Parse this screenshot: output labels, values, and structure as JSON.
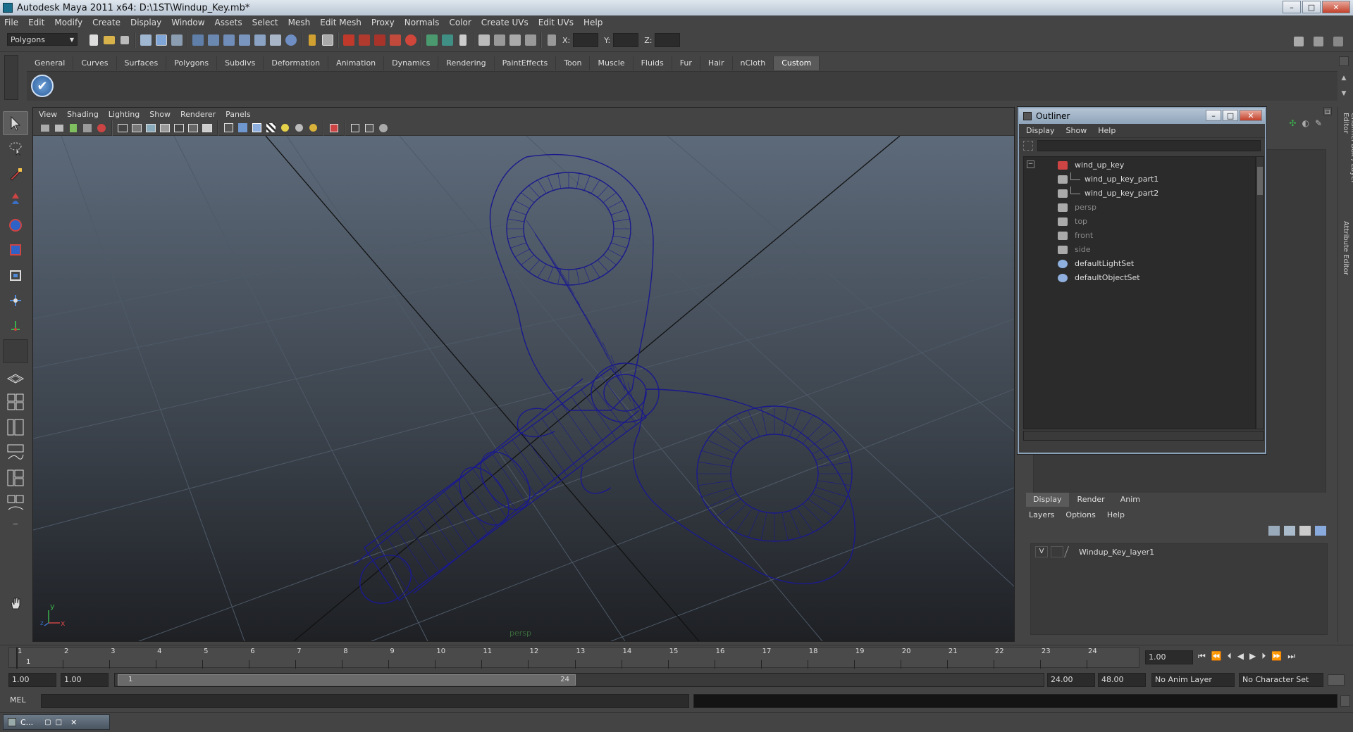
{
  "window": {
    "title": "Autodesk Maya 2011 x64: D:\\1ST\\Windup_Key.mb*",
    "controls": [
      "–",
      "□",
      "✕"
    ]
  },
  "menubar": [
    "File",
    "Edit",
    "Modify",
    "Create",
    "Display",
    "Window",
    "Assets",
    "Select",
    "Mesh",
    "Edit Mesh",
    "Proxy",
    "Normals",
    "Color",
    "Create UVs",
    "Edit UVs",
    "Help"
  ],
  "statusline": {
    "mode": "Polygons",
    "x_label": "X:",
    "y_label": "Y:",
    "z_label": "Z:"
  },
  "shelf": {
    "tabs": [
      "General",
      "Curves",
      "Surfaces",
      "Polygons",
      "Subdivs",
      "Deformation",
      "Animation",
      "Dynamics",
      "Rendering",
      "PaintEffects",
      "Toon",
      "Muscle",
      "Fluids",
      "Fur",
      "Hair",
      "nCloth",
      "Custom"
    ],
    "active": "Custom"
  },
  "viewport": {
    "menu": [
      "View",
      "Shading",
      "Lighting",
      "Show",
      "Renderer",
      "Panels"
    ],
    "camera_label": "persp",
    "axis_y": "y",
    "axis_x": "x",
    "axis_z": "z",
    "wire_color": "#1a1a8c"
  },
  "outliner": {
    "title": "Outliner",
    "menu": [
      "Display",
      "Show",
      "Help"
    ],
    "items": [
      {
        "label": "wind_up_key",
        "dim": false
      },
      {
        "label": "wind_up_key_part1",
        "dim": false
      },
      {
        "label": "wind_up_key_part2",
        "dim": false
      },
      {
        "label": "persp",
        "dim": true
      },
      {
        "label": "top",
        "dim": true
      },
      {
        "label": "front",
        "dim": true
      },
      {
        "label": "side",
        "dim": true
      },
      {
        "label": "defaultLightSet",
        "dim": false
      },
      {
        "label": "defaultObjectSet",
        "dim": false
      }
    ],
    "collapse_glyph": "−"
  },
  "side_tabs": [
    "Channel Box / Layer Editor",
    "Attribute Editor"
  ],
  "layers": {
    "tabs": [
      "Display",
      "Render",
      "Anim"
    ],
    "menu": [
      "Layers",
      "Options",
      "Help"
    ],
    "visibility": "V",
    "layer_name": "Windup_Key_layer1"
  },
  "timeline": {
    "ticks": [
      "1",
      "2",
      "3",
      "4",
      "5",
      "6",
      "7",
      "8",
      "9",
      "10",
      "11",
      "12",
      "13",
      "14",
      "15",
      "16",
      "17",
      "18",
      "19",
      "20",
      "21",
      "22",
      "23",
      "24"
    ],
    "current_frame_marker": "1",
    "current_time": "1.00"
  },
  "range": {
    "start": "1.00",
    "playback_start": "1.00",
    "slider_start": "1",
    "slider_end": "24",
    "playback_end": "24.00",
    "end": "48.00",
    "anim_layer": "No Anim Layer",
    "character_set": "No Character Set"
  },
  "cmdline": {
    "label": "MEL"
  },
  "taskbar": {
    "item": "C..."
  }
}
